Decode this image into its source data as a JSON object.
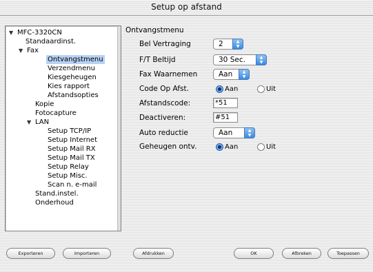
{
  "window": {
    "title": "Setup op afstand"
  },
  "tree": {
    "items": [
      {
        "label": "MFC-3320CN",
        "expanded": true,
        "level": 0,
        "selected": false
      },
      {
        "label": "Standaardinst.",
        "expanded": null,
        "level": 1,
        "selected": false
      },
      {
        "label": "Fax",
        "expanded": true,
        "level": 1,
        "selected": false
      },
      {
        "label": "Ontvangstmenu",
        "expanded": null,
        "level": 2,
        "selected": true
      },
      {
        "label": "Verzendmenu",
        "expanded": null,
        "level": 2,
        "selected": false
      },
      {
        "label": "Kiesgeheugen",
        "expanded": null,
        "level": 2,
        "selected": false
      },
      {
        "label": "Kies rapport",
        "expanded": null,
        "level": 2,
        "selected": false
      },
      {
        "label": "Afstandsopties",
        "expanded": null,
        "level": 2,
        "selected": false
      },
      {
        "label": "Kopie",
        "expanded": null,
        "level": 1,
        "selected": false
      },
      {
        "label": "Fotocapture",
        "expanded": null,
        "level": 1,
        "selected": false
      },
      {
        "label": "LAN",
        "expanded": true,
        "level": 1,
        "selected": false
      },
      {
        "label": "Setup TCP/IP",
        "expanded": null,
        "level": 2,
        "selected": false
      },
      {
        "label": "Setup Internet",
        "expanded": null,
        "level": 2,
        "selected": false
      },
      {
        "label": "Setup Mail RX",
        "expanded": null,
        "level": 2,
        "selected": false
      },
      {
        "label": "Setup Mail TX",
        "expanded": null,
        "level": 2,
        "selected": false
      },
      {
        "label": "Setup Relay",
        "expanded": null,
        "level": 2,
        "selected": false
      },
      {
        "label": "Setup Misc.",
        "expanded": null,
        "level": 2,
        "selected": false
      },
      {
        "label": "Scan n. e-mail",
        "expanded": null,
        "level": 2,
        "selected": false
      },
      {
        "label": "Stand.instel.",
        "expanded": null,
        "level": 1,
        "selected": false
      },
      {
        "label": "Onderhoud",
        "expanded": null,
        "level": 1,
        "selected": false
      }
    ]
  },
  "panel": {
    "section_title": "Ontvangstmenu",
    "bel_vertraging": {
      "label": "Bel Vertraging",
      "value": "2"
    },
    "ft_beltijd": {
      "label": "F/T Beltijd",
      "value": "30 Sec."
    },
    "fax_waarnemen": {
      "label": "Fax Waarnemen",
      "value": "Aan"
    },
    "code_op_afst": {
      "label": "Code Op Afst.",
      "option_on": "Aan",
      "option_off": "Uit",
      "selected": "Aan"
    },
    "afstandscode": {
      "label": "Afstandscode:",
      "value": "*51"
    },
    "deactiveren": {
      "label": "Deactiveren:",
      "value": "#51"
    },
    "auto_reductie": {
      "label": "Auto reductie",
      "value": "Aan"
    },
    "geheugen_ontv": {
      "label": "Geheugen ontv.",
      "option_on": "Aan",
      "option_off": "Uit",
      "selected": "Aan"
    }
  },
  "buttons": {
    "export": "Exporteren",
    "import": "Importeren",
    "print": "Afdrukken",
    "ok": "OK",
    "cancel": "Afbreken",
    "apply": "Toepassen"
  },
  "icons": {
    "expanded": "triangle-down-icon",
    "popup": "up-down-arrows-icon"
  },
  "colors": {
    "selection": "#b7d1f4",
    "accent": "#3a8ae0"
  }
}
